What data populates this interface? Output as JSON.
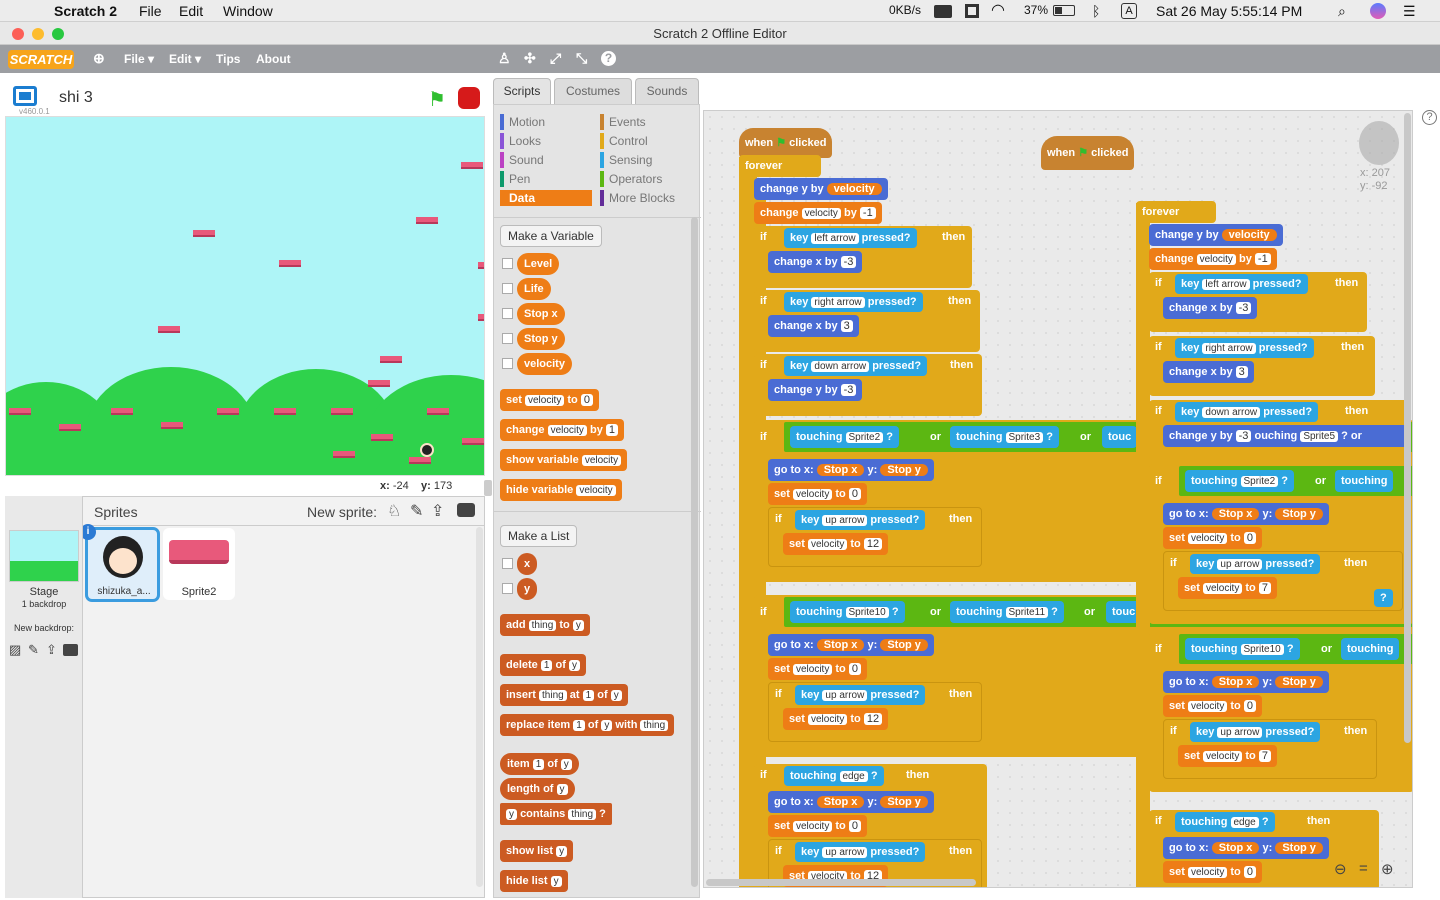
{
  "os": {
    "app": "Scratch 2",
    "menus": [
      "File",
      "Edit",
      "Window"
    ],
    "net": "0KB/s",
    "battery": "37%",
    "datetime": "Sat 26 May  5:55:14 PM"
  },
  "window": {
    "title": "Scratch 2 Offline Editor"
  },
  "menubar": {
    "logo": "SCRATCH",
    "file": "File ▾",
    "edit": "Edit ▾",
    "tips": "Tips",
    "about": "About"
  },
  "stage": {
    "project_name": "shi 3",
    "version": "v460.0.1",
    "x_label": "x:",
    "x": "-24",
    "y_label": "y:",
    "y": "173"
  },
  "sprites_pane": {
    "title": "Sprites",
    "new_sprite": "New sprite:",
    "stage_label": "Stage",
    "backdrops": "1 backdrop",
    "new_backdrop": "New backdrop:",
    "items": [
      {
        "name": "shizuka_a..."
      },
      {
        "name": "Sprite2"
      }
    ]
  },
  "tabs": {
    "scripts": "Scripts",
    "costumes": "Costumes",
    "sounds": "Sounds"
  },
  "categories": [
    {
      "label": "Motion",
      "color": "#4a6cd4"
    },
    {
      "label": "Events",
      "color": "#c88330"
    },
    {
      "label": "Looks",
      "color": "#8a55d7"
    },
    {
      "label": "Control",
      "color": "#e1a91a"
    },
    {
      "label": "Sound",
      "color": "#bb42c3"
    },
    {
      "label": "Sensing",
      "color": "#2ca5e2"
    },
    {
      "label": "Pen",
      "color": "#0e9a6c"
    },
    {
      "label": "Operators",
      "color": "#5cb712"
    },
    {
      "label": "Data",
      "color": "#ee7d16"
    },
    {
      "label": "More Blocks",
      "color": "#632d99"
    }
  ],
  "palette": {
    "make_var": "Make a Variable",
    "variables": [
      "Level",
      "Life",
      "Stop x",
      "Stop y",
      "velocity"
    ],
    "set": {
      "a": "set",
      "v": "velocity",
      "b": "to",
      "n": "0"
    },
    "change": {
      "a": "change",
      "v": "velocity",
      "b": "by",
      "n": "1"
    },
    "show_var": {
      "a": "show variable",
      "v": "velocity"
    },
    "hide_var": {
      "a": "hide variable",
      "v": "velocity"
    },
    "make_list": "Make a List",
    "lists": [
      "x",
      "y"
    ],
    "add": {
      "a": "add",
      "t": "thing",
      "b": "to",
      "l": "y"
    },
    "delete": {
      "a": "delete",
      "n": "1",
      "b": "of",
      "l": "y"
    },
    "insert": {
      "a": "insert",
      "t": "thing",
      "b": "at",
      "n": "1",
      "c": "of",
      "l": "y"
    },
    "replace": {
      "a": "replace",
      "b": "item",
      "n": "1",
      "c": "of",
      "l": "y",
      "d": "with",
      "t": "thing"
    },
    "item": {
      "a": "item",
      "n": "1",
      "b": "of",
      "l": "y"
    },
    "length": {
      "a": "length",
      "b": "of",
      "l": "y"
    },
    "contains": {
      "l": "y",
      "a": "contains",
      "t": "thing",
      "q": "?"
    },
    "show_list": {
      "a": "show list",
      "l": "y"
    },
    "hide_list": {
      "a": "hide list",
      "l": "y"
    }
  },
  "script1": {
    "hat": {
      "a": "when",
      "b": "clicked"
    },
    "forever": "forever",
    "r1": {
      "a": "change y by",
      "v": "velocity"
    },
    "r2": {
      "a": "change",
      "v": "velocity",
      "b": "by",
      "n": "-1"
    },
    "if1": {
      "if": "if",
      "key": "key",
      "k": "left arrow",
      "p": "pressed?",
      "then": "then",
      "body": "change x by",
      "n": "-3"
    },
    "if2": {
      "if": "if",
      "key": "key",
      "k": "right arrow",
      "p": "pressed?",
      "then": "then",
      "body": "change x by",
      "n": "3"
    },
    "if3": {
      "if": "if",
      "key": "key",
      "k": "down arrow",
      "p": "pressed?",
      "then": "then",
      "body": "change y by",
      "n": "-3"
    },
    "if4": {
      "if": "if",
      "t1": "touching",
      "s1": "Sprite2",
      "q": "?",
      "or": "or",
      "t2": "touching",
      "s2": "Sprite3",
      "q2": "?",
      "or2": "or",
      "t3": "touc",
      "goto": "go to x:",
      "gx": "Stop x",
      "gy_l": "y:",
      "gy": "Stop y",
      "set": "set",
      "sv": "velocity",
      "to": "to",
      "n": "0",
      "key": "key",
      "k": "up arrow",
      "p": "pressed?",
      "then": "then",
      "set2": "set",
      "sv2": "velocity",
      "to2": "to",
      "n2": "12"
    },
    "if5": {
      "if": "if",
      "t1": "touching",
      "s1": "Sprite10",
      "q": "?",
      "or": "or",
      "t2": "touching",
      "s2": "Sprite11",
      "q2": "?",
      "or2": "or",
      "t3": "touc",
      "goto": "go to x:",
      "gx": "Stop x",
      "gy_l": "y:",
      "gy": "Stop y",
      "set": "set",
      "sv": "velocity",
      "to": "to",
      "n": "0",
      "key": "key",
      "k": "up arrow",
      "p": "pressed?",
      "then": "then",
      "set2": "set",
      "sv2": "velocity",
      "to2": "to",
      "n2": "12"
    },
    "if6": {
      "if": "if",
      "t1": "touching",
      "s1": "edge",
      "q": "?",
      "then": "then",
      "goto": "go to x:",
      "gx": "Stop x",
      "gy_l": "y:",
      "gy": "Stop y",
      "set": "set",
      "sv": "velocity",
      "to": "to",
      "n": "0",
      "key": "key",
      "k": "up arrow",
      "p": "pressed?",
      "set2": "set",
      "sv2": "velocity",
      "to2": "to",
      "n2": "12"
    }
  },
  "script2": {
    "hat": {
      "a": "when",
      "b": "clicked"
    },
    "forever": "forever",
    "r1": {
      "a": "change y by",
      "v": "velocity"
    },
    "r2": {
      "a": "change",
      "v": "velocity",
      "b": "by",
      "n": "-1"
    },
    "if1": {
      "if": "if",
      "key": "key",
      "k": "left arrow",
      "p": "pressed?",
      "then": "then",
      "body": "change x by",
      "n": "-3"
    },
    "if2": {
      "if": "if",
      "key": "key",
      "k": "right arrow",
      "p": "pressed?",
      "then": "then",
      "body": "change x by",
      "n": "3"
    },
    "if3": {
      "if": "if",
      "key": "key",
      "k": "down arrow",
      "p": "pressed?",
      "then": "then",
      "body": "change y by",
      "n": "-3",
      "t": "ouching",
      "s": "Sprite5",
      "q": "?",
      "or": "or"
    },
    "if4": {
      "if": "if",
      "t1": "touching",
      "s1": "Sprite2",
      "q": "?",
      "or": "or",
      "t2": "touching",
      "goto": "go to x:",
      "gx": "Stop x",
      "gy_l": "y:",
      "gy": "Stop y",
      "set": "set",
      "sv": "velocity",
      "to": "to",
      "n": "0",
      "key": "key",
      "k": "up arrow",
      "p": "pressed?",
      "then": "then",
      "set2": "set",
      "sv2": "velocity",
      "to2": "to",
      "n2": "7",
      "q3": "?"
    },
    "if5": {
      "if": "if",
      "t1": "touching",
      "s1": "Sprite10",
      "q": "?",
      "or": "or",
      "t2": "touching",
      "goto": "go to x:",
      "gx": "Stop x",
      "gy_l": "y:",
      "gy": "Stop y",
      "set": "set",
      "sv": "velocity",
      "to": "to",
      "n": "0",
      "key": "key",
      "k": "up arrow",
      "p": "pressed?",
      "then": "then",
      "set2": "set",
      "sv2": "velocity",
      "to2": "to",
      "n2": "7"
    },
    "if6": {
      "if": "if",
      "t1": "touching",
      "s1": "edge",
      "q": "?",
      "then": "then",
      "goto": "go to x:",
      "gx": "Stop x",
      "gy_l": "y:",
      "gy": "Stop y",
      "set": "set",
      "sv": "velocity",
      "to": "to",
      "n": "0"
    }
  },
  "sprite_info": {
    "x": "x: 207",
    "y": "y: -92"
  }
}
